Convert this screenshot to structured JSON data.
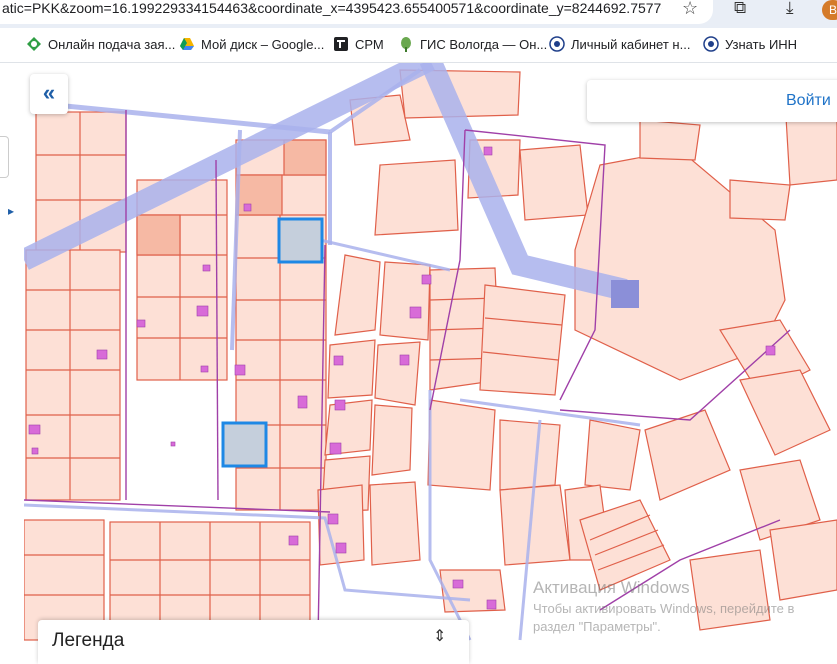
{
  "browser": {
    "url": "atic=PKK&zoom=16.199229334154463&coordinate_x=4395423.655400571&coordinate_y=8244692.75770...",
    "avatar_letter": "B",
    "bookmarks": [
      {
        "label": "Онлайн подача зая...",
        "icon": "leaf-icon",
        "color": "#2f9e44"
      },
      {
        "label": "Мой диск – Google...",
        "icon": "drive-icon",
        "color": "#f4b400"
      },
      {
        "label": "СРМ",
        "icon": "crm-icon",
        "color": "#202124"
      },
      {
        "label": "ГИС Вологда — Он...",
        "icon": "pin-icon",
        "color": "#6aa84f"
      },
      {
        "label": "Личный кабинет н...",
        "icon": "emblem-icon",
        "color": "#1f3f8a"
      },
      {
        "label": "Узнать ИНН",
        "icon": "emblem-icon",
        "color": "#1f3f8a"
      }
    ]
  },
  "map": {
    "login_label": "Войти",
    "legend_label": "Легенда",
    "scale_label": "",
    "colors": {
      "parcel_fill": "#fde0d6",
      "parcel_stroke": "#e0604a",
      "road": "#a9b1ec",
      "selected_stroke": "#1e88e5",
      "building": "#d86bd8"
    }
  },
  "watermark": {
    "line1": "Активация Windows",
    "line2": "Чтобы активировать Windows, перейдите в",
    "line3": "раздел \"Параметры\"."
  }
}
